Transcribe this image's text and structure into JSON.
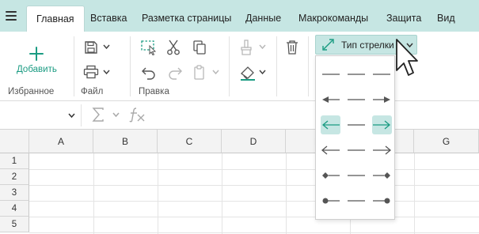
{
  "tabs": [
    {
      "label": "Главная",
      "active": true
    },
    {
      "label": "Вставка",
      "active": false
    },
    {
      "label": "Разметка страницы",
      "active": false
    },
    {
      "label": "Данные",
      "active": false
    },
    {
      "label": "Макрокоманды",
      "active": false
    },
    {
      "label": "Защита",
      "active": false
    },
    {
      "label": "Вид",
      "active": false
    }
  ],
  "ribbon": {
    "favorites": {
      "add_label": "Добавить",
      "group_label": "Избранное"
    },
    "file": {
      "group_label": "Файл"
    },
    "edit": {
      "group_label": "Правка"
    },
    "arrow_type": {
      "label": "Тип стрелки"
    }
  },
  "arrow_options": [
    {
      "name": "none-none"
    },
    {
      "name": "arrow-arrow",
      "start": "arrow",
      "end": "arrow"
    },
    {
      "name": "open-open",
      "start": "open-arrow",
      "end": "open-arrow",
      "highlighted": true
    },
    {
      "name": "stealth-stealth",
      "start": "stealth",
      "end": "stealth"
    },
    {
      "name": "diamond-diamond",
      "start": "diamond",
      "end": "diamond"
    },
    {
      "name": "oval-oval",
      "start": "oval",
      "end": "oval"
    }
  ],
  "grid": {
    "columns": [
      "A",
      "B",
      "C",
      "D",
      "E",
      "F",
      "G"
    ],
    "rows": [
      "1",
      "2",
      "3",
      "4",
      "5"
    ]
  },
  "colors": {
    "accent": "#1a9b82",
    "tabbar": "#c6e6e3",
    "highlight": "#c6e6e3"
  }
}
